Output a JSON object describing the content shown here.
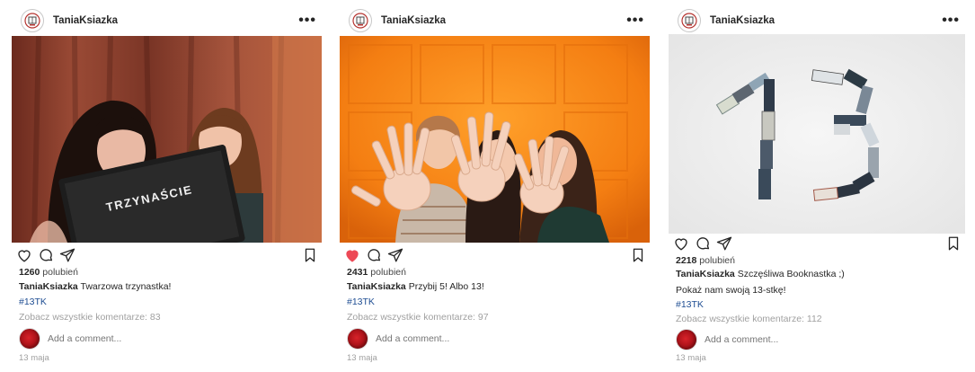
{
  "posts": [
    {
      "username": "TaniaKsiazka",
      "likes_count": "1260",
      "likes_word": "polubień",
      "caption": "Twarzowa trzynastka!",
      "hashtag": "#13TK",
      "view_comments": "Zobacz wszystkie komentarze: 83",
      "add_comment_placeholder": "Add a comment...",
      "date": "13 maja",
      "sign_text": "TRZYNAŚCIE",
      "liked": false
    },
    {
      "username": "TaniaKsiazka",
      "likes_count": "2431",
      "likes_word": "polubień",
      "caption": "Przybij 5! Albo 13!",
      "hashtag": "#13TK",
      "view_comments": "Zobacz wszystkie komentarze: 97",
      "add_comment_placeholder": "Add a comment...",
      "date": "13 maja",
      "liked": true
    },
    {
      "username": "TaniaKsiazka",
      "likes_count": "2218",
      "likes_word": "polubień",
      "caption": "Szczęśliwa Booknastka ;)",
      "caption_line2": "Pokaż nam swoją 13-stkę!",
      "hashtag": "#13TK",
      "view_comments": "Zobacz wszystkie komentarze: 112",
      "add_comment_placeholder": "Add a comment...",
      "date": "13 maja",
      "liked": false
    }
  ],
  "colors": {
    "like_red": "#ed4956",
    "hashtag_blue": "#1e4d92",
    "muted_gray": "#a0a0a0"
  },
  "icons": [
    "more-options-icon",
    "heart-icon",
    "comment-icon",
    "share-icon",
    "bookmark-icon"
  ]
}
